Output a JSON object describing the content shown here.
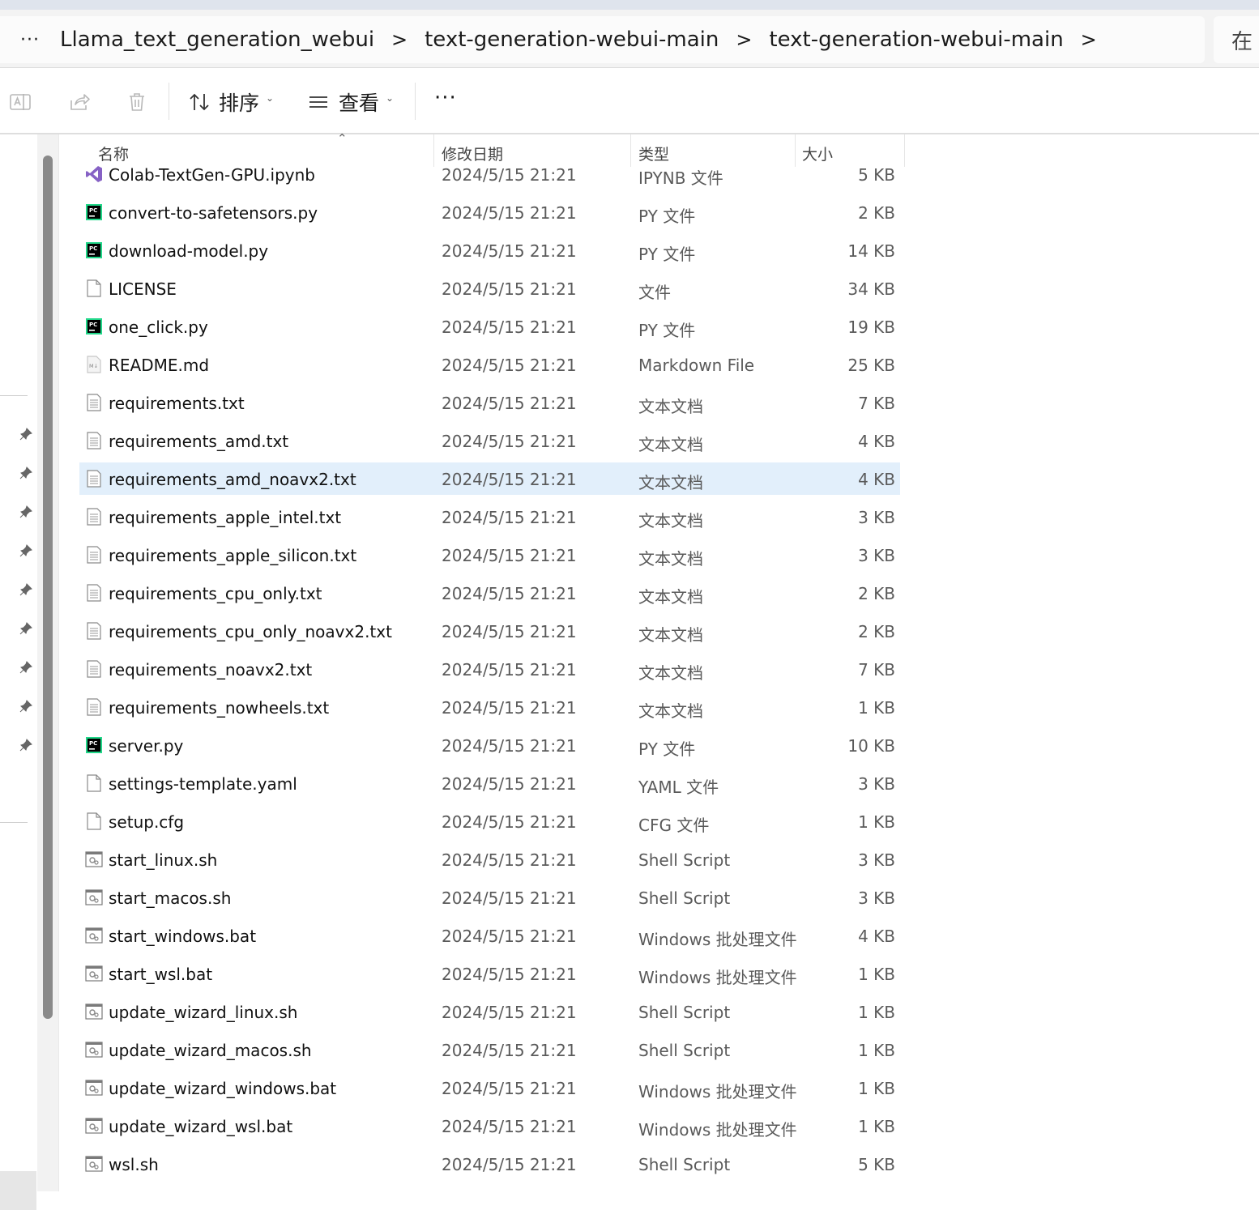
{
  "breadcrumb": {
    "more_label": "···",
    "items": [
      "Llama_text_generation_webui",
      "text-generation-webui-main",
      "text-generation-webui-main"
    ],
    "separator": ">"
  },
  "search": {
    "partial_label": "在"
  },
  "toolbar": {
    "sort_label": "排序",
    "view_label": "查看",
    "more_label": "···"
  },
  "columns": {
    "name": "名称",
    "date": "修改日期",
    "type": "类型",
    "size": "大小"
  },
  "files": [
    {
      "name": "Colab-TextGen-GPU.ipynb",
      "date": "2024/5/15 21:21",
      "type": "IPYNB 文件",
      "size": "5 KB",
      "icon": "ipynb-file-icon"
    },
    {
      "name": "convert-to-safetensors.py",
      "date": "2024/5/15 21:21",
      "type": "PY 文件",
      "size": "2 KB",
      "icon": "pycharm-file-icon"
    },
    {
      "name": "download-model.py",
      "date": "2024/5/15 21:21",
      "type": "PY 文件",
      "size": "14 KB",
      "icon": "pycharm-file-icon"
    },
    {
      "name": "LICENSE",
      "date": "2024/5/15 21:21",
      "type": "文件",
      "size": "34 KB",
      "icon": "blank-file-icon"
    },
    {
      "name": "one_click.py",
      "date": "2024/5/15 21:21",
      "type": "PY 文件",
      "size": "19 KB",
      "icon": "pycharm-file-icon"
    },
    {
      "name": "README.md",
      "date": "2024/5/15 21:21",
      "type": "Markdown File",
      "size": "25 KB",
      "icon": "markdown-file-icon"
    },
    {
      "name": "requirements.txt",
      "date": "2024/5/15 21:21",
      "type": "文本文档",
      "size": "7 KB",
      "icon": "text-file-icon"
    },
    {
      "name": "requirements_amd.txt",
      "date": "2024/5/15 21:21",
      "type": "文本文档",
      "size": "4 KB",
      "icon": "text-file-icon"
    },
    {
      "name": "requirements_amd_noavx2.txt",
      "date": "2024/5/15 21:21",
      "type": "文本文档",
      "size": "4 KB",
      "icon": "text-file-icon",
      "selected": true
    },
    {
      "name": "requirements_apple_intel.txt",
      "date": "2024/5/15 21:21",
      "type": "文本文档",
      "size": "3 KB",
      "icon": "text-file-icon"
    },
    {
      "name": "requirements_apple_silicon.txt",
      "date": "2024/5/15 21:21",
      "type": "文本文档",
      "size": "3 KB",
      "icon": "text-file-icon"
    },
    {
      "name": "requirements_cpu_only.txt",
      "date": "2024/5/15 21:21",
      "type": "文本文档",
      "size": "2 KB",
      "icon": "text-file-icon"
    },
    {
      "name": "requirements_cpu_only_noavx2.txt",
      "date": "2024/5/15 21:21",
      "type": "文本文档",
      "size": "2 KB",
      "icon": "text-file-icon"
    },
    {
      "name": "requirements_noavx2.txt",
      "date": "2024/5/15 21:21",
      "type": "文本文档",
      "size": "7 KB",
      "icon": "text-file-icon"
    },
    {
      "name": "requirements_nowheels.txt",
      "date": "2024/5/15 21:21",
      "type": "文本文档",
      "size": "1 KB",
      "icon": "text-file-icon"
    },
    {
      "name": "server.py",
      "date": "2024/5/15 21:21",
      "type": "PY 文件",
      "size": "10 KB",
      "icon": "pycharm-file-icon"
    },
    {
      "name": "settings-template.yaml",
      "date": "2024/5/15 21:21",
      "type": "YAML 文件",
      "size": "3 KB",
      "icon": "blank-file-icon"
    },
    {
      "name": "setup.cfg",
      "date": "2024/5/15 21:21",
      "type": "CFG 文件",
      "size": "1 KB",
      "icon": "blank-file-icon"
    },
    {
      "name": "start_linux.sh",
      "date": "2024/5/15 21:21",
      "type": "Shell Script",
      "size": "3 KB",
      "icon": "script-file-icon"
    },
    {
      "name": "start_macos.sh",
      "date": "2024/5/15 21:21",
      "type": "Shell Script",
      "size": "3 KB",
      "icon": "script-file-icon"
    },
    {
      "name": "start_windows.bat",
      "date": "2024/5/15 21:21",
      "type": "Windows 批处理文件",
      "size": "4 KB",
      "icon": "script-file-icon"
    },
    {
      "name": "start_wsl.bat",
      "date": "2024/5/15 21:21",
      "type": "Windows 批处理文件",
      "size": "1 KB",
      "icon": "script-file-icon"
    },
    {
      "name": "update_wizard_linux.sh",
      "date": "2024/5/15 21:21",
      "type": "Shell Script",
      "size": "1 KB",
      "icon": "script-file-icon"
    },
    {
      "name": "update_wizard_macos.sh",
      "date": "2024/5/15 21:21",
      "type": "Shell Script",
      "size": "1 KB",
      "icon": "script-file-icon"
    },
    {
      "name": "update_wizard_windows.bat",
      "date": "2024/5/15 21:21",
      "type": "Windows 批处理文件",
      "size": "1 KB",
      "icon": "script-file-icon"
    },
    {
      "name": "update_wizard_wsl.bat",
      "date": "2024/5/15 21:21",
      "type": "Windows 批处理文件",
      "size": "1 KB",
      "icon": "script-file-icon"
    },
    {
      "name": "wsl.sh",
      "date": "2024/5/15 21:21",
      "type": "Shell Script",
      "size": "5 KB",
      "icon": "script-file-icon"
    }
  ],
  "colors": {
    "selection": "#e2effb",
    "accent": "#0067c0"
  }
}
